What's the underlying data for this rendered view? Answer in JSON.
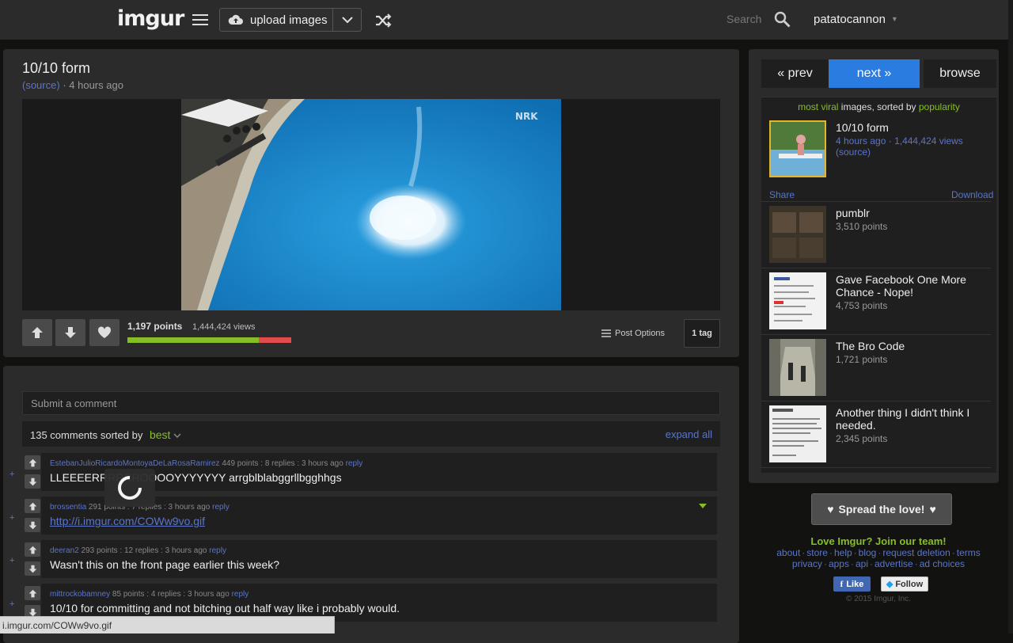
{
  "header": {
    "logo": "imgur",
    "upload_label": "upload images",
    "search_placeholder": "Search",
    "username": "patatocannon",
    "icons": [
      "menu-icon",
      "cloud-upload-icon",
      "chevron-down-icon",
      "shuffle-icon",
      "search-icon",
      "caret-down-icon"
    ]
  },
  "post": {
    "title": "10/10 form",
    "source_label": "(source)",
    "time_ago": "4 hours ago",
    "points": "1,197 points",
    "views": "1,444,424 views",
    "upvote_ratio": 0.8,
    "post_options_label": "Post Options",
    "tags_label": "1 tag",
    "watermark": "NRK"
  },
  "comments": {
    "input_placeholder": "Submit a comment",
    "count_text": "135 comments sorted by",
    "sort_label": "best",
    "expand_label": "expand all",
    "items": [
      {
        "author": "EstebanJulioRicardoMontoyaDeLaRosaRamirez",
        "meta": "449 points : 8 replies : 3 hours ago",
        "reply": "reply",
        "text": "LLEEEERRRRRROOOOYYYYYYY arrgblblabggrllbgghhgs"
      },
      {
        "author": "brossentia",
        "meta": "291 points : 7 replies : 3 hours ago",
        "reply": "reply",
        "text": "http://i.imgur.com/COWw9vo.gif"
      },
      {
        "author": "deeran2",
        "meta": "293 points : 12 replies : 3 hours ago",
        "reply": "reply",
        "text": "Wasn't this on the front page earlier this week?"
      },
      {
        "author": "mittrockobamney",
        "meta": "85 points : 4 replies : 3 hours ago",
        "reply": "reply",
        "text": "10/10 for committing and not bitching out half way like i probably would."
      }
    ]
  },
  "status_url": "i.imgur.com/COWw9vo.gif",
  "sidebar": {
    "prev_label": "« prev",
    "next_label": "next »",
    "browse_label": "browse",
    "viral_prefix": "most viral",
    "viral_middle": " images, sorted by ",
    "viral_suffix": "popularity",
    "items": [
      {
        "title": "10/10 form",
        "time": "4 hours ago",
        "views": "1,444,424 views",
        "source": "(source)",
        "share": "Share",
        "download": "Download"
      },
      {
        "title": "pumblr",
        "points": "3,510 points"
      },
      {
        "title": "Gave Facebook One More Chance - Nope!",
        "points": "4,753 points"
      },
      {
        "title": "The Bro Code",
        "points": "1,721 points"
      },
      {
        "title": "Another thing I didn't think I needed.",
        "points": "2,345 points"
      }
    ]
  },
  "footer": {
    "spread_label": "Spread the love!",
    "join_label": "Love Imgur? Join our team!",
    "links_row1": [
      "about",
      "store",
      "help",
      "blog",
      "request deletion",
      "terms"
    ],
    "links_row2": [
      "privacy",
      "apps",
      "api",
      "advertise",
      "ad choices"
    ],
    "fb_label": "Like",
    "tw_label": "Follow",
    "copyright": "© 2015 Imgur, Inc."
  },
  "colors": {
    "accent_green": "#85bf25",
    "accent_blue": "#5b75c9",
    "next_blue": "#2b7ce0",
    "downvote_red": "#e04b4b"
  }
}
